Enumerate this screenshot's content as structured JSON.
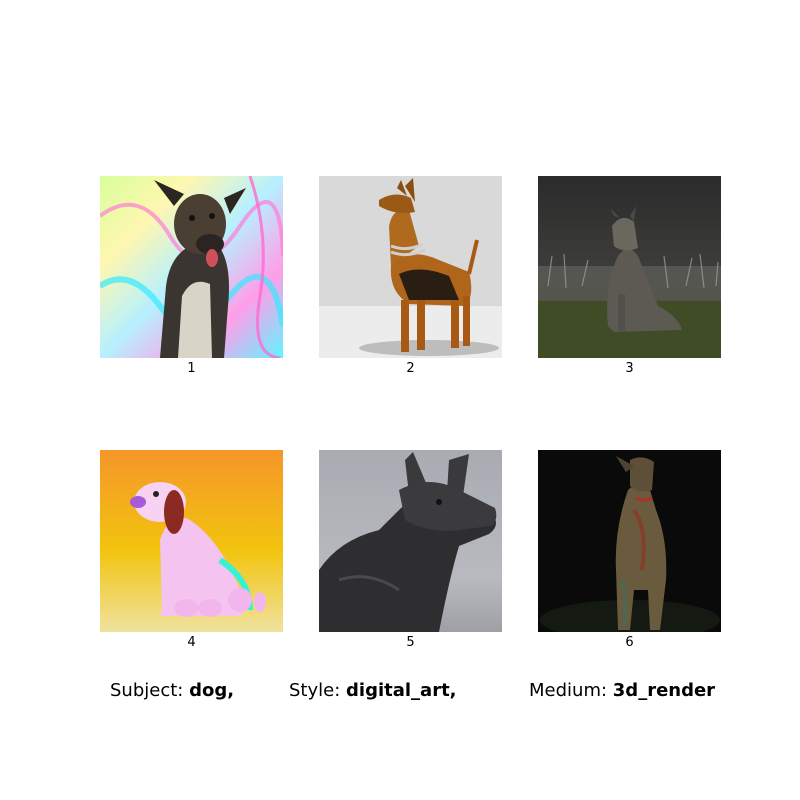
{
  "images": [
    {
      "label": "1",
      "subject": "dog",
      "background": "iridescent-swirl"
    },
    {
      "label": "2",
      "subject": "dog",
      "background": "light-gray-studio"
    },
    {
      "label": "3",
      "subject": "dog",
      "background": "dark-grass-field"
    },
    {
      "label": "4",
      "subject": "dog",
      "background": "orange-yellow-gradient"
    },
    {
      "label": "5",
      "subject": "dog",
      "background": "gray-studio-closeup"
    },
    {
      "label": "6",
      "subject": "dog",
      "background": "black"
    }
  ],
  "captions": {
    "subject": {
      "key": "Subject:",
      "value": "dog,"
    },
    "style": {
      "key": "Style:",
      "value": "digital_art,"
    },
    "medium": {
      "key": "Medium:",
      "value": "3d_render"
    }
  }
}
